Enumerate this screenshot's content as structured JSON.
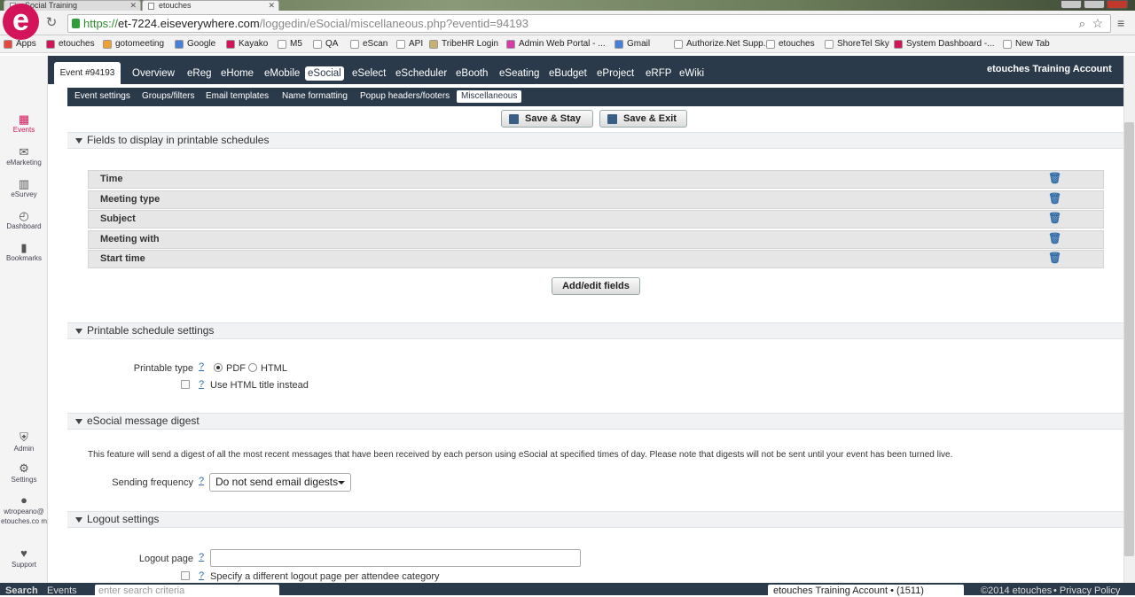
{
  "browser": {
    "tabs": [
      {
        "label": "eSocial Training"
      },
      {
        "label": "etouches"
      }
    ],
    "url_scheme": "https://",
    "url_host": "et-7224.eiseverywhere.com",
    "url_rest": "/loggedin/eSocial/miscellaneous.php?eventid=94193",
    "bookmarks": [
      {
        "label": "Apps",
        "color": "#e8473d"
      },
      {
        "label": "etouches",
        "color": "#d4145a"
      },
      {
        "label": "gotomeeting",
        "color": "#f0a030"
      },
      {
        "label": "Google",
        "color": "#4a7fd8"
      },
      {
        "label": "Kayako",
        "color": "#d4145a"
      },
      {
        "label": "M5",
        "color": "#ffffff"
      },
      {
        "label": "QA",
        "color": "#ffffff"
      },
      {
        "label": "eScan",
        "color": "#ffffff"
      },
      {
        "label": "API",
        "color": "#ffffff"
      },
      {
        "label": "TribeHR Login",
        "color": "#c8b070"
      },
      {
        "label": "Admin Web Portal - ...",
        "color": "#d43aa8"
      },
      {
        "label": "Gmail",
        "color": "#4a7fd8"
      },
      {
        "label": "Authorize.Net Supp...",
        "color": "#ffffff"
      },
      {
        "label": "etouches",
        "color": "#ffffff"
      },
      {
        "label": "ShoreTel Sky",
        "color": "#ffffff"
      },
      {
        "label": "System Dashboard -...",
        "color": "#d4145a"
      },
      {
        "label": "New Tab",
        "color": "#ffffff"
      }
    ]
  },
  "sidebar": {
    "logo": "e",
    "items": [
      {
        "label": "Events",
        "icon": "calendar-icon"
      },
      {
        "label": "eMarketing",
        "icon": "envelope-icon"
      },
      {
        "label": "eSurvey",
        "icon": "bar-chart-icon"
      },
      {
        "label": "Dashboard",
        "icon": "gauge-icon"
      },
      {
        "label": "Bookmarks",
        "icon": "bookmark-icon"
      }
    ],
    "bottom_items": [
      {
        "label": "Admin",
        "icon": "shield-icon"
      },
      {
        "label": "Settings",
        "icon": "gear-icon"
      },
      {
        "label": "wtropeano@ etouches.co m",
        "icon": "user-icon"
      },
      {
        "label": "Support",
        "icon": "heart-icon"
      }
    ]
  },
  "topnav": {
    "event_label": "Event #94193",
    "items": [
      "Overview",
      "eReg",
      "eHome",
      "eMobile",
      "eSocial",
      "eSelect",
      "eScheduler",
      "eBooth",
      "eSeating",
      "eBudget",
      "eProject",
      "eRFP",
      "eWiki"
    ],
    "selected": "eSocial",
    "account": "etouches Training Account"
  },
  "subnav": {
    "items": [
      "Event settings",
      "Groups/filters",
      "Email templates",
      "Name formatting",
      "Popup headers/footers",
      "Miscellaneous"
    ],
    "selected": "Miscellaneous"
  },
  "actions": {
    "save_stay": "Save & Stay",
    "save_exit": "Save & Exit"
  },
  "fields_section": {
    "title": "Fields to display in printable schedules",
    "fields": [
      "Time",
      "Meeting type",
      "Subject",
      "Meeting with",
      "Start time"
    ],
    "add_edit": "Add/edit fields"
  },
  "printable_section": {
    "title": "Printable schedule settings",
    "type_label": "Printable type",
    "help": "?",
    "options": [
      "PDF",
      "HTML"
    ],
    "selected": "PDF",
    "html_title_label": "Use HTML title instead"
  },
  "digest_section": {
    "title": "eSocial message digest",
    "description": "This feature will send a digest of all the most recent messages that have been received by each person using eSocial at specified times of day. Please note that digests will not be sent until your event has been turned live.",
    "frequency_label": "Sending frequency",
    "frequency_value": "Do not send email digests"
  },
  "logout_section": {
    "title": "Logout settings",
    "page_label": "Logout page",
    "page_value": "",
    "per_category_label": "Specify a different logout page per attendee category"
  },
  "footer": {
    "search_label": "Search",
    "scope": "Events",
    "search_placeholder": "enter search criteria",
    "account_select": "etouches Training Account • (1511)",
    "copyright": "©2014 etouches",
    "privacy": "• Privacy Policy"
  }
}
